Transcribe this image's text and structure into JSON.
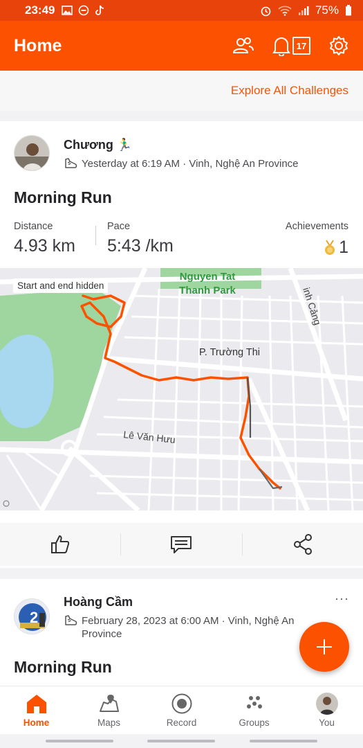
{
  "status_bar": {
    "time": "23:49",
    "battery": "75%",
    "icons": [
      "image-icon",
      "minus-circle-icon",
      "tiktok-icon",
      "alarm-icon",
      "wifi-icon",
      "signal-icon",
      "battery-icon"
    ]
  },
  "app_bar": {
    "title": "Home",
    "notification_count": "17",
    "icons": [
      "people-icon",
      "bell-icon",
      "inbox-icon",
      "gear-icon"
    ]
  },
  "challenges_link": "Explore All Challenges",
  "feed": [
    {
      "athlete": "Chương 🏃‍♂️",
      "meta": "Yesterday at 6:19 AM · Vinh, Nghệ An Province",
      "title": "Morning Run",
      "stats": {
        "distance_label": "Distance",
        "distance_value": "4.93 km",
        "pace_label": "Pace",
        "pace_value": "5:43 /km",
        "achievements_label": "Achievements",
        "achievements_value": "1"
      },
      "map": {
        "privacy_note": "Start and end hidden",
        "labels": {
          "park": "Nguyen Tat\nThanh Park",
          "ward": "P. Trường Thi",
          "street1": "Lê Văn Hưu",
          "street2": "inh Cảng"
        }
      }
    },
    {
      "athlete": "Hoàng Cầm",
      "meta_line1": "February 28, 2023 at 6:00 AM · Vinh, Nghệ An",
      "meta_line2": "Province",
      "title": "Morning Run",
      "more": "···"
    }
  ],
  "social_actions": [
    "thumbs-up-icon",
    "comment-icon",
    "share-icon"
  ],
  "tabs": [
    {
      "label": "Home",
      "icon": "home-icon",
      "active": true
    },
    {
      "label": "Maps",
      "icon": "maps-icon",
      "active": false
    },
    {
      "label": "Record",
      "icon": "record-icon",
      "active": false
    },
    {
      "label": "Groups",
      "icon": "groups-icon",
      "active": false
    },
    {
      "label": "You",
      "icon": "avatar",
      "active": false
    }
  ],
  "colors": {
    "brand": "#fc5200",
    "status_bar": "#e8430a",
    "park": "#9fd59f",
    "lake": "#a8d8f0"
  }
}
